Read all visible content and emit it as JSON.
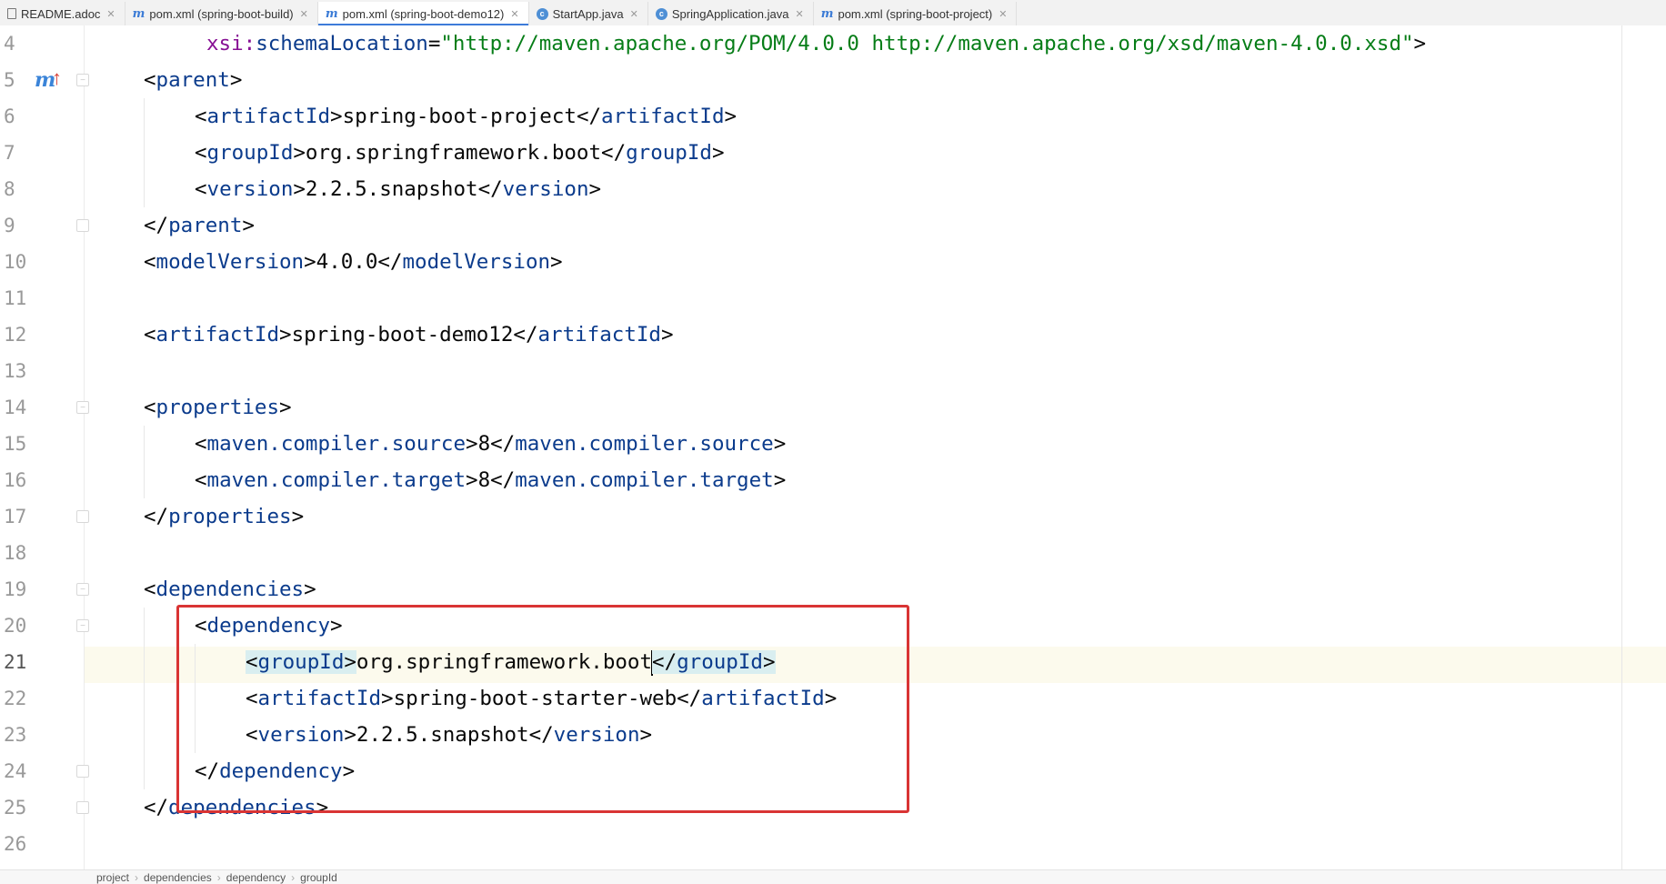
{
  "tabs": [
    {
      "label": "README.adoc",
      "icon": "document-icon",
      "active": false
    },
    {
      "label": "pom.xml (spring-boot-build)",
      "icon": "maven-icon",
      "active": false
    },
    {
      "label": "pom.xml (spring-boot-demo12)",
      "icon": "maven-icon",
      "active": true
    },
    {
      "label": "StartApp.java",
      "icon": "java-class-icon",
      "active": false
    },
    {
      "label": "SpringApplication.java",
      "icon": "java-class-icon",
      "active": false
    },
    {
      "label": "pom.xml (spring-boot-project)",
      "icon": "maven-icon",
      "active": false
    }
  ],
  "editor": {
    "lines": [
      {
        "num": "4"
      },
      {
        "num": "5",
        "gutter_icon": "maven-parent-icon"
      },
      {
        "num": "6"
      },
      {
        "num": "7"
      },
      {
        "num": "8"
      },
      {
        "num": "9"
      },
      {
        "num": "10"
      },
      {
        "num": "11"
      },
      {
        "num": "12"
      },
      {
        "num": "13"
      },
      {
        "num": "14"
      },
      {
        "num": "15"
      },
      {
        "num": "16"
      },
      {
        "num": "17"
      },
      {
        "num": "18"
      },
      {
        "num": "19"
      },
      {
        "num": "20"
      },
      {
        "num": "21"
      },
      {
        "num": "22"
      },
      {
        "num": "23"
      },
      {
        "num": "24"
      },
      {
        "num": "25"
      },
      {
        "num": "26"
      }
    ],
    "code": {
      "l4": {
        "attr_ns": "xsi",
        "attr_name": "schemaLocation",
        "attr_value": "\"http://maven.apache.org/POM/4.0.0 http://maven.apache.org/xsd/maven-4.0.0.xsd\""
      },
      "l5": {
        "tag": "parent"
      },
      "l6": {
        "tag": "artifactId",
        "text": "spring-boot-project"
      },
      "l7": {
        "tag": "groupId",
        "text": "org.springframework.boot"
      },
      "l8": {
        "tag": "version",
        "text": "2.2.5.snapshot"
      },
      "l9": {
        "tag": "parent"
      },
      "l10": {
        "tag": "modelVersion",
        "text": "4.0.0"
      },
      "l12": {
        "tag": "artifactId",
        "text": "spring-boot-demo12"
      },
      "l14": {
        "tag": "properties"
      },
      "l15": {
        "tag": "maven.compiler.source",
        "text": "8"
      },
      "l16": {
        "tag": "maven.compiler.target",
        "text": "8"
      },
      "l17": {
        "tag": "properties"
      },
      "l19": {
        "tag": "dependencies"
      },
      "l20": {
        "tag": "dependency"
      },
      "l21": {
        "tag": "groupId",
        "text": "org.springframework.boot"
      },
      "l22": {
        "tag": "artifactId",
        "text": "spring-boot-starter-web"
      },
      "l23": {
        "tag": "version",
        "text": "2.2.5.snapshot"
      },
      "l24": {
        "tag": "dependency"
      },
      "l25": {
        "tag": "dependencies"
      }
    },
    "caret_line": "21"
  },
  "breadcrumb": [
    "project",
    "dependencies",
    "dependency",
    "groupId"
  ],
  "colors": {
    "tag": "#0b3b8c",
    "attribute_namespace": "#871094",
    "attribute_value": "#067d17",
    "highlight_box": "#d93434",
    "active_tab_underline": "#3d7bd9"
  }
}
